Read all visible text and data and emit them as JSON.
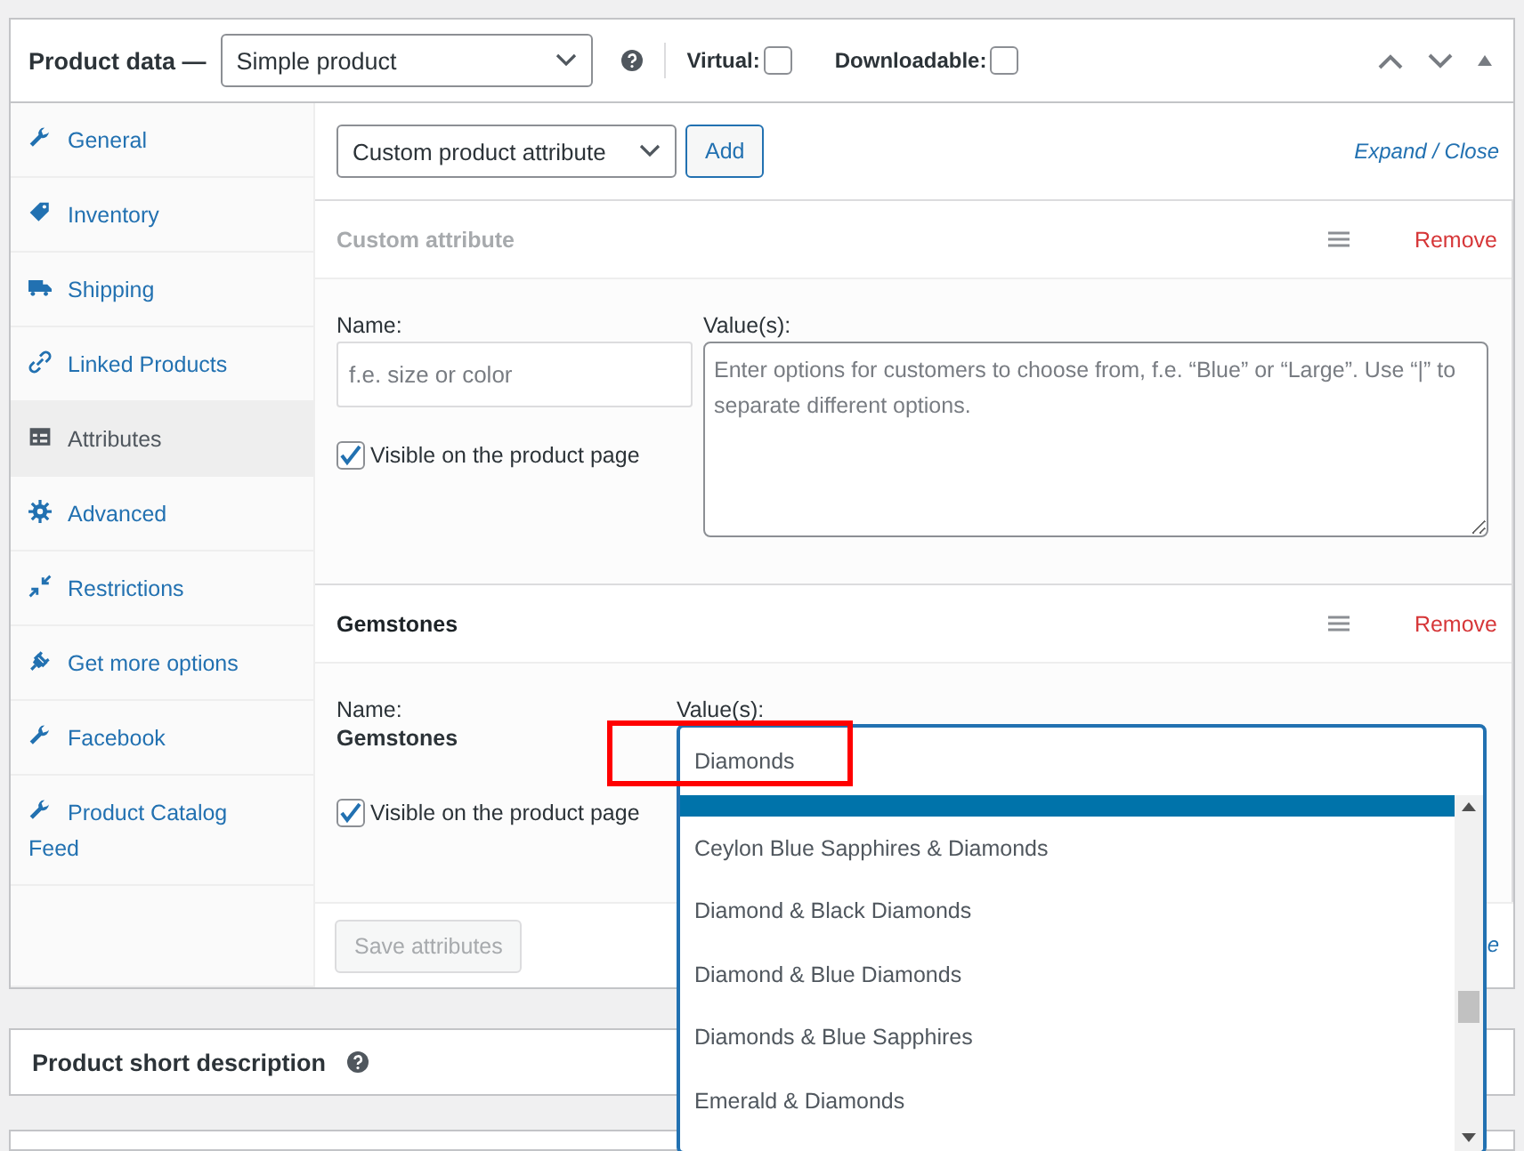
{
  "header": {
    "title": "Product data —",
    "product_type": "Simple product",
    "virtual": {
      "label": "Virtual:",
      "checked": false
    },
    "downloadable": {
      "label": "Downloadable:",
      "checked": false
    }
  },
  "tabs": [
    {
      "label": "General",
      "selected": false
    },
    {
      "label": "Inventory",
      "selected": false
    },
    {
      "label": "Shipping",
      "selected": false
    },
    {
      "label": "Linked Products",
      "selected": false
    },
    {
      "label": "Attributes",
      "selected": true
    },
    {
      "label": "Advanced",
      "selected": false
    },
    {
      "label": "Restrictions",
      "selected": false
    },
    {
      "label": "Get more options",
      "selected": false
    },
    {
      "label": "Facebook",
      "selected": false
    },
    {
      "label": "Product Catalog Feed",
      "selected": false
    }
  ],
  "toolbar": {
    "attribute_select": "Custom product attribute",
    "add_button": "Add",
    "expand_close": "Expand / Close"
  },
  "attributes": [
    {
      "kind": "custom",
      "title": "Custom attribute",
      "remove": "Remove",
      "name_label": "Name:",
      "name_placeholder": "f.e. size or color",
      "values_label": "Value(s):",
      "values_placeholder": "Enter options for customers to choose from, f.e. “Blue” or “Large”. Use “|” to separate different options.",
      "visible": {
        "label": "Visible on the product page",
        "checked": true
      }
    },
    {
      "kind": "taxonomy",
      "title": "Gemstones",
      "remove": "Remove",
      "name_label": "Name:",
      "name_value": "Gemstones",
      "values_label": "Value(s):",
      "visible": {
        "label": "Visible on the product page",
        "checked": true
      }
    }
  ],
  "dropdown": {
    "search_value": "Diamonds",
    "options": [
      {
        "label": "Ceylon Blue Sapphires & Diamonds"
      },
      {
        "label": "Diamond & Black Diamonds"
      },
      {
        "label": "Diamond & Blue Diamonds"
      },
      {
        "label": "Diamonds & Blue Sapphires"
      },
      {
        "label": "Emerald & Diamonds"
      }
    ]
  },
  "save_button": {
    "label": "Save attributes",
    "disabled": true
  },
  "bottom_expand_close": "e",
  "short_description": {
    "title": "Product short description"
  }
}
